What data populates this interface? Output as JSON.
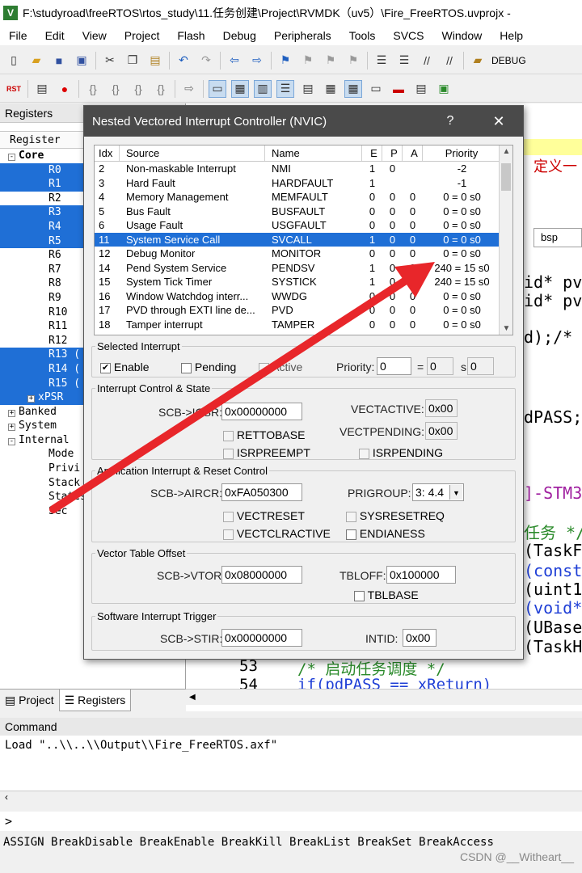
{
  "window": {
    "title": "F:\\studyroad\\freeRTOS\\rtos_study\\11.任务创建\\Project\\RVMDK（uv5）\\Fire_FreeRTOS.uvprojx -",
    "app_icon": "V"
  },
  "menubar": [
    "File",
    "Edit",
    "View",
    "Project",
    "Flash",
    "Debug",
    "Peripherals",
    "Tools",
    "SVCS",
    "Window",
    "Help"
  ],
  "toolbar": {
    "debug_label": "DEBUG",
    "rst_label": "RST"
  },
  "registers_panel": {
    "title": "Registers",
    "column_header": "Register",
    "tree": [
      {
        "label": "Core",
        "level": 0,
        "expander": "-",
        "bold": true,
        "selected": false
      },
      {
        "label": "R0",
        "level": 1,
        "selected": true
      },
      {
        "label": "R1",
        "level": 1,
        "selected": true
      },
      {
        "label": "R2",
        "level": 1,
        "selected": false
      },
      {
        "label": "R3",
        "level": 1,
        "selected": true
      },
      {
        "label": "R4",
        "level": 1,
        "selected": true
      },
      {
        "label": "R5",
        "level": 1,
        "selected": true
      },
      {
        "label": "R6",
        "level": 1,
        "selected": false
      },
      {
        "label": "R7",
        "level": 1,
        "selected": false
      },
      {
        "label": "R8",
        "level": 1,
        "selected": false
      },
      {
        "label": "R9",
        "level": 1,
        "selected": false
      },
      {
        "label": "R10",
        "level": 1,
        "selected": false
      },
      {
        "label": "R11",
        "level": 1,
        "selected": false
      },
      {
        "label": "R12",
        "level": 1,
        "selected": false
      },
      {
        "label": "R13 (",
        "level": 1,
        "selected": true
      },
      {
        "label": "R14 (",
        "level": 1,
        "selected": true
      },
      {
        "label": "R15 (",
        "level": 1,
        "selected": true
      },
      {
        "label": "xPSR",
        "level": 1,
        "expander": "+",
        "selected": true
      },
      {
        "label": "Banked",
        "level": 0,
        "expander": "+",
        "selected": false
      },
      {
        "label": "System",
        "level": 0,
        "expander": "+",
        "selected": false
      },
      {
        "label": "Internal",
        "level": 0,
        "expander": "-",
        "selected": false
      },
      {
        "label": "Mode",
        "level": 1,
        "selected": false
      },
      {
        "label": "Privi",
        "level": 1,
        "selected": false
      },
      {
        "label": "Stack",
        "level": 1,
        "selected": false
      },
      {
        "label": "States",
        "level": 1,
        "selected": false
      },
      {
        "label": "Sec",
        "level": 1,
        "selected": false
      }
    ],
    "tabs": [
      "Project",
      "Registers"
    ]
  },
  "code": {
    "fragments": [
      "定义一",
      "bsp",
      "id* pv",
      "id* pv",
      "d);/*",
      "dPASS;",
      "]-STM3",
      "任务 */",
      "(TaskF",
      "(const",
      "(uint1",
      "(void*",
      "(UBase",
      "(TaskH"
    ],
    "line_53": "53",
    "line_54": "54",
    "line_53_code": "/* 启动任务调度 */",
    "line_54_code": "if(pdPASS == xReturn)"
  },
  "command": {
    "title": "Command",
    "output": "Load \"..\\\\..\\\\Output\\\\Fire_FreeRTOS.axf\"",
    "prompt": ">",
    "hints": "ASSIGN BreakDisable BreakEnable BreakKill BreakList BreakSet BreakAccess"
  },
  "watermark": "CSDN @__Witheart__",
  "nvic": {
    "title": "Nested Vectored Interrupt Controller (NVIC)",
    "help": "?",
    "close": "✕",
    "columns": [
      "Idx",
      "Source",
      "Name",
      "E",
      "P",
      "A",
      "Priority"
    ],
    "rows": [
      {
        "idx": "2",
        "source": "Non-maskable Interrupt",
        "name": "NMI",
        "e": "1",
        "p": "0",
        "a": "",
        "priority": "-2",
        "selected": false
      },
      {
        "idx": "3",
        "source": "Hard Fault",
        "name": "HARDFAULT",
        "e": "1",
        "p": "",
        "a": "",
        "priority": "-1",
        "selected": false
      },
      {
        "idx": "4",
        "source": "Memory Management",
        "name": "MEMFAULT",
        "e": "0",
        "p": "0",
        "a": "0",
        "priority": "0 = 0 s0",
        "selected": false
      },
      {
        "idx": "5",
        "source": "Bus Fault",
        "name": "BUSFAULT",
        "e": "0",
        "p": "0",
        "a": "0",
        "priority": "0 = 0 s0",
        "selected": false
      },
      {
        "idx": "6",
        "source": "Usage Fault",
        "name": "USGFAULT",
        "e": "0",
        "p": "0",
        "a": "0",
        "priority": "0 = 0 s0",
        "selected": false
      },
      {
        "idx": "11",
        "source": "System Service Call",
        "name": "SVCALL",
        "e": "1",
        "p": "0",
        "a": "0",
        "priority": "0 = 0 s0",
        "selected": true
      },
      {
        "idx": "12",
        "source": "Debug Monitor",
        "name": "MONITOR",
        "e": "0",
        "p": "0",
        "a": "0",
        "priority": "0 = 0 s0",
        "selected": false
      },
      {
        "idx": "14",
        "source": "Pend System Service",
        "name": "PENDSV",
        "e": "1",
        "p": "0",
        "a": "0",
        "priority": "240 = 15 s0",
        "selected": false
      },
      {
        "idx": "15",
        "source": "System Tick Timer",
        "name": "SYSTICK",
        "e": "1",
        "p": "0",
        "a": "0",
        "priority": "240 = 15 s0",
        "selected": false
      },
      {
        "idx": "16",
        "source": "Window Watchdog interr...",
        "name": "WWDG",
        "e": "0",
        "p": "0",
        "a": "0",
        "priority": "0 = 0 s0",
        "selected": false
      },
      {
        "idx": "17",
        "source": "PVD through EXTI line de...",
        "name": "PVD",
        "e": "0",
        "p": "0",
        "a": "0",
        "priority": "0 = 0 s0",
        "selected": false
      },
      {
        "idx": "18",
        "source": "Tamper interrupt",
        "name": "TAMPER",
        "e": "0",
        "p": "0",
        "a": "0",
        "priority": "0 = 0 s0",
        "selected": false
      }
    ],
    "selected_interrupt": {
      "legend": "Selected Interrupt",
      "enable_label": "Enable",
      "enable_checked": true,
      "pending_label": "Pending",
      "active_label": "Active",
      "priority_label": "Priority:",
      "priority_value": "0",
      "eq": "=",
      "group_value": "0",
      "s_label": "s",
      "sub_value": "0"
    },
    "icsr": {
      "legend": "Interrupt Control & State",
      "label": "SCB->ICSR:",
      "value": "0x00000000",
      "vectactive_label": "VECTACTIVE:",
      "vectactive_value": "0x00",
      "vectpending_label": "VECTPENDING:",
      "vectpending_value": "0x00",
      "rettobase": "RETTOBASE",
      "isrpreempt": "ISRPREEMPT",
      "isrpending": "ISRPENDING"
    },
    "aircr": {
      "legend": "Application Interrupt & Reset Control",
      "label": "SCB->AIRCR:",
      "value": "0xFA050300",
      "prigroup_label": "PRIGROUP:",
      "prigroup_value": "3: 4.4",
      "vectreset": "VECTRESET",
      "sysresetreq": "SYSRESETREQ",
      "vectclractive": "VECTCLRACTIVE",
      "endianess": "ENDIANESS"
    },
    "vtor": {
      "legend": "Vector Table Offset",
      "label": "SCB->VTOR:",
      "value": "0x08000000",
      "tbloff_label": "TBLOFF:",
      "tbloff_value": "0x100000",
      "tblbase": "TBLBASE"
    },
    "stir": {
      "legend": "Software Interrupt Trigger",
      "label": "SCB->STIR:",
      "value": "0x00000000",
      "intid_label": "INTID:",
      "intid_value": "0x00"
    }
  },
  "colors": {
    "selection": "#1f6fd6",
    "annotation_arrow": "#e8262a",
    "dialog_titlebar": "#4a4a4a"
  }
}
